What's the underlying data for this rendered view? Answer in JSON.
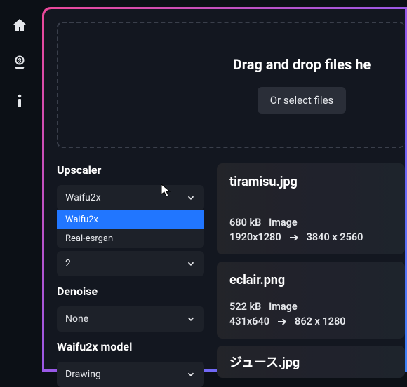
{
  "dropzone": {
    "text": "Drag and drop files he",
    "button": "Or select files"
  },
  "controls": {
    "upscaler": {
      "label": "Upscaler",
      "value": "Waifu2x",
      "options": [
        "Waifu2x",
        "Real-esrgan"
      ]
    },
    "scale": {
      "value": "2"
    },
    "denoise": {
      "label": "Denoise",
      "value": "None"
    },
    "model": {
      "label": "Waifu2x model",
      "value": "Drawing"
    }
  },
  "files": [
    {
      "name": "tiramisu.jpg",
      "size": "680 kB",
      "type": "Image",
      "src_dims": "1920x1280",
      "dst_dims": "3840 x 2560"
    },
    {
      "name": "eclair.png",
      "size": "522 kB",
      "type": "Image",
      "src_dims": "431x640",
      "dst_dims": "862 x 1280"
    },
    {
      "name": "ジュース.jpg"
    }
  ]
}
